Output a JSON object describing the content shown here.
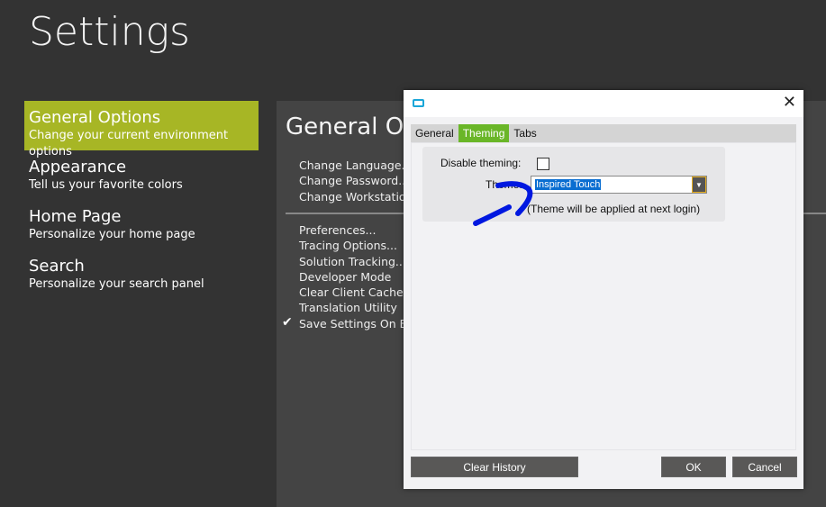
{
  "page_title": "Settings",
  "nav": [
    {
      "title": "General Options",
      "subtitle": "Change your current environment options"
    },
    {
      "title": "Appearance",
      "subtitle": "Tell us your favorite colors"
    },
    {
      "title": "Home Page",
      "subtitle": "Personalize your home page"
    },
    {
      "title": "Search",
      "subtitle": "Personalize your search panel"
    }
  ],
  "panel": {
    "heading": "General Op",
    "group1": [
      "Change Language...",
      "Change Password...",
      "Change Workstation..."
    ],
    "group2": [
      "Preferences...",
      "Tracing Options...",
      "Solution Tracking...",
      "Developer Mode",
      "Clear Client Cache",
      "Translation Utility",
      "Save Settings On Exit"
    ]
  },
  "dialog": {
    "tabs": [
      "General",
      "Theming",
      "Tabs"
    ],
    "disable_label": "Disable theming:",
    "theme_label": "Theme:",
    "theme_value": "Inspired Touch",
    "note": "(Theme will be applied at next login)",
    "clear_history": "Clear History",
    "ok": "OK",
    "cancel": "Cancel",
    "close": "✕"
  },
  "colors": {
    "accent": "#a7b625",
    "tab_active": "#6ab628",
    "scribble": "#0018e0"
  }
}
